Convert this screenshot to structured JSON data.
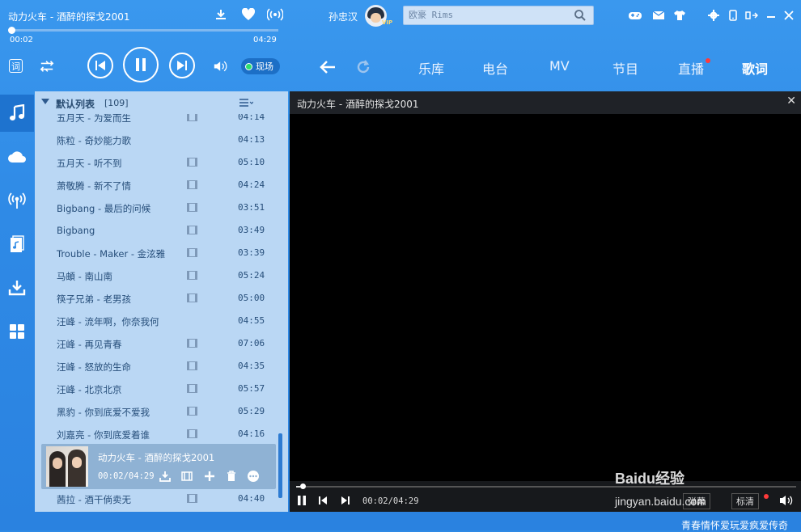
{
  "player": {
    "song_title": "动力火车 - 酒醉的探戈2001",
    "current_time": "00:02",
    "total_time": "04:29",
    "progress": 0.008,
    "live_label": "现场",
    "lyric_btn": "词"
  },
  "user": {
    "name": "孙忠汉",
    "vip": "VIP"
  },
  "search": {
    "value": "欧豪 Rims"
  },
  "nav": {
    "items": [
      "乐库",
      "电台",
      "MV",
      "节目",
      "直播",
      "歌词"
    ],
    "active": "歌词"
  },
  "playlist": {
    "name": "默认列表",
    "count": "[109]",
    "rows": [
      {
        "text": "五月天 - 为爱而生",
        "duration": "04:14",
        "mv": true
      },
      {
        "text": "陈粒 - 奇妙能力歌",
        "duration": "04:13",
        "mv": false
      },
      {
        "text": "五月天 - 听不到",
        "duration": "05:10",
        "mv": true
      },
      {
        "text": "萧敬腾 - 新不了情",
        "duration": "04:24",
        "mv": true
      },
      {
        "text": "Bigbang - 最后的问候",
        "duration": "03:51",
        "mv": true
      },
      {
        "text": "Bigbang",
        "duration": "03:49",
        "mv": true
      },
      {
        "text": "Trouble - Maker - 金泫雅",
        "duration": "03:39",
        "mv": true
      },
      {
        "text": "马頔 - 南山南",
        "duration": "05:24",
        "mv": true
      },
      {
        "text": "筷子兄弟 - 老男孩",
        "duration": "05:00",
        "mv": true
      },
      {
        "text": "汪峰 - 流年啊，你奈我何",
        "duration": "04:55",
        "mv": false
      },
      {
        "text": "汪峰 - 再见青春",
        "duration": "07:06",
        "mv": true
      },
      {
        "text": "汪峰 - 怒放的生命",
        "duration": "04:35",
        "mv": true
      },
      {
        "text": "汪峰 - 北京北京",
        "duration": "05:57",
        "mv": true
      },
      {
        "text": "黑豹 - 你到底爱不爱我",
        "duration": "05:29",
        "mv": true
      },
      {
        "text": "刘嘉亮 - 你到底爱着谁",
        "duration": "04:16",
        "mv": true
      }
    ],
    "now_playing": {
      "text": "动力火车 - 酒醉的探戈2001",
      "time": "00:02/04:29"
    },
    "last_row": {
      "text": "茜拉 - 酒干倘卖无",
      "duration": "04:40",
      "mv": true
    }
  },
  "video": {
    "title": "动力火车 - 酒醉的探戈2001",
    "time": "00:02/04:29",
    "progress": 0.008,
    "tab1": "弹幕",
    "tab2": "标清"
  },
  "footer": {
    "text": "青春情怀爱玩爱疯爱传奇",
    "watermark": "Baidu经验",
    "watermark_url": "jingyan.baidu.com"
  }
}
